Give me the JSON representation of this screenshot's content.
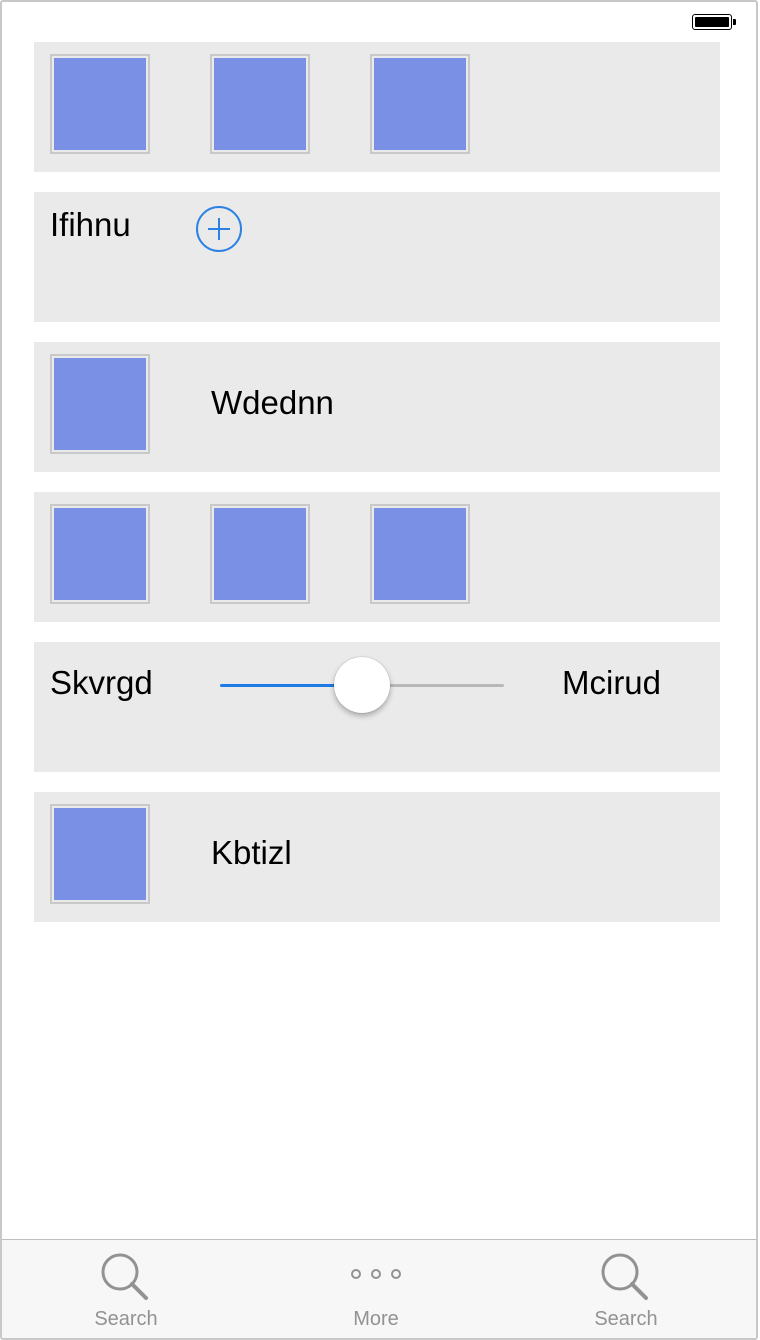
{
  "status_bar": {
    "battery_icon": "battery-full-icon"
  },
  "row1": {
    "tiles": [
      "image-placeholder",
      "image-placeholder",
      "image-placeholder"
    ]
  },
  "row2": {
    "label": "Ifihnu",
    "button_icon": "add-circle-icon"
  },
  "row3": {
    "label": "Wdednn",
    "tile": "image-placeholder"
  },
  "row4": {
    "tiles": [
      "image-placeholder",
      "image-placeholder",
      "image-placeholder"
    ]
  },
  "row5": {
    "min_label": "Skvrgd",
    "max_label": "Mcirud",
    "slider_value": 0.5
  },
  "row6": {
    "label": "Kbtizl",
    "tile": "image-placeholder"
  },
  "tab_bar": {
    "items": [
      {
        "label": "Search",
        "icon": "search-icon"
      },
      {
        "label": "More",
        "icon": "more-icon"
      },
      {
        "label": "Search",
        "icon": "search-icon"
      }
    ]
  },
  "colors": {
    "accent": "#2b82e5",
    "tile_fill": "#7990e4",
    "row_background": "#eaeaea",
    "tab_label": "#929292"
  }
}
